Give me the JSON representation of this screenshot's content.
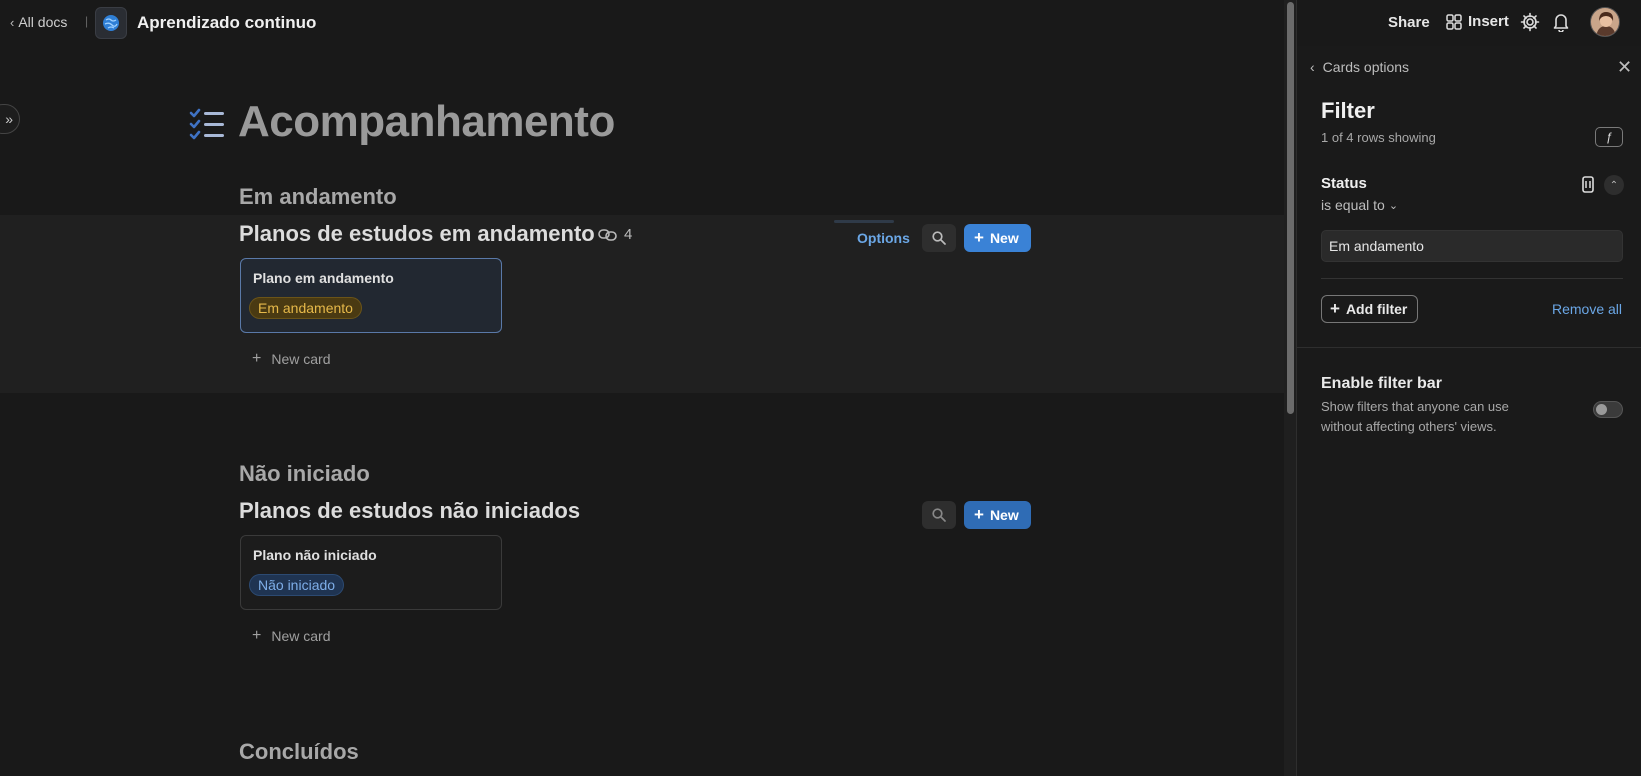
{
  "topbar": {
    "back_label": "All docs",
    "doc_title": "Aprendizado continuo",
    "share_label": "Share",
    "insert_label": "Insert"
  },
  "page": {
    "title": "Acompanhamento"
  },
  "sections": [
    {
      "heading": "Em andamento",
      "table_title": "Planos de estudos em andamento",
      "linked_count": "4",
      "options_label": "Options",
      "new_label": "New",
      "card": {
        "title": "Plano em andamento",
        "status": "Em andamento"
      },
      "new_card_label": "New card"
    },
    {
      "heading": "Não iniciado",
      "table_title": "Planos de estudos não iniciados",
      "new_label": "New",
      "card": {
        "title": "Plano não iniciado",
        "status": "Não iniciado"
      },
      "new_card_label": "New card"
    },
    {
      "heading": "Concluídos"
    }
  ],
  "panel": {
    "back_label": "Cards options",
    "title": "Filter",
    "rows_showing": "1 of 4 rows showing",
    "filter": {
      "field": "Status",
      "operator": "is equal to",
      "value": "Em andamento"
    },
    "add_filter_label": "Add filter",
    "remove_all_label": "Remove all",
    "filter_bar": {
      "title": "Enable filter bar",
      "description": "Show filters that anyone can use without affecting others' views.",
      "enabled": false
    }
  },
  "colors": {
    "accent": "#3a82d6",
    "link": "#6ba7e6",
    "pill_progress": "#e6b94a",
    "pill_not_started": "#7eaee8"
  }
}
